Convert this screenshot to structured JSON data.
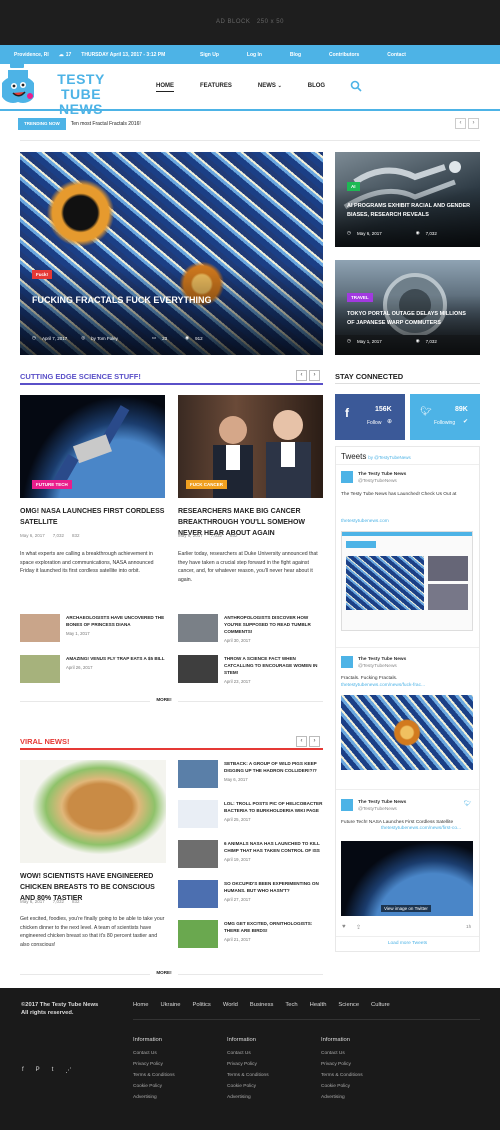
{
  "ad": {
    "label": "AD BLOCK",
    "size": "250 x 50"
  },
  "topbar": {
    "location": "Providence, RI",
    "temp": "17",
    "date": "THURSDAY April 13, 2017 - 3:12 PM",
    "links": [
      "Sign Up",
      "Log In",
      "Blog",
      "Contributors",
      "Contact"
    ]
  },
  "logo": {
    "line1": "TESTY TUBE",
    "line2": "NEWS"
  },
  "nav": [
    "HOME",
    "FEATURES",
    "NEWS",
    "BLOG"
  ],
  "trending": {
    "label": "TRENDING NOW",
    "text": "Ten most Fractal Fractals 2016!"
  },
  "hero": {
    "tag": "Fuck!",
    "title": "FUCKING FRACTALS FUCK EVERYTHING",
    "date": "April 7, 2017",
    "author": "by Tom Foley",
    "comments": "23",
    "views": "912"
  },
  "side": [
    {
      "tag": "AI",
      "title": "AI PROGRAMS EXHIBIT RACIAL AND GENDER BIASES, RESEARCH REVEALS",
      "date": "May 6, 2017",
      "views": "7,032"
    },
    {
      "tag": "TRAVEL",
      "title": "TOKYO PORTAL OUTAGE DELAYS MILLIONS OF JAPANESE WARP COMMUTERS",
      "date": "May 1, 2017",
      "views": "7,032"
    }
  ],
  "science": {
    "title": "CUTTING EDGE SCIENCE STUFF!",
    "main": [
      {
        "tag": "FUTURE TECH",
        "title": "OMG! NASA LAUNCHES FIRST CORDLESS SATELLITE",
        "date": "May 6, 2017",
        "views": "7,032",
        "comments": "832",
        "body": "In what experts are calling a breakthrough achievement in space exploration and communications, NASA announced Friday it launched its first cordless satellite into orbit."
      },
      {
        "tag": "FUCK CANCER",
        "title": "RESEARCHERS MAKE BIG CANCER BREAKTHROUGH YOU'LL SOMEHOW NEVER HEAR ABOUT AGAIN",
        "date": "May 6, 2017",
        "views": "7,032",
        "comments": "832",
        "body": "Earlier today, researchers at Duke University announced that they have taken a crucial step forward in the fight against cancer, and, for whatever reason, you'll never hear about it again."
      }
    ],
    "mini": [
      {
        "title": "ARCHAEOLOGISTS HAVE UNCOVERED THE BONES OF PRINCESS DIANA",
        "date": "May 1, 2017"
      },
      {
        "title": "ANTHROPOLOGISTS DISCOVER HOW YOU'RE SUPPOSED TO READ TUMBLR COMMENTS!",
        "date": "April 30, 2017"
      },
      {
        "title": "AMAZING! VENUS FLY TRAP EATS A $5 BILL",
        "date": "April 26, 2017"
      },
      {
        "title": "THROW A SCIENCE FACT WHEN CATCALLING TO ENCOURAGE WOMEN IN STEM!",
        "date": "April 23, 2017"
      }
    ],
    "more": "MORE!"
  },
  "stay": {
    "title": "STAY CONNECTED",
    "fb_count": "156K",
    "fb_label": "Follow",
    "tw_count": "89K",
    "tw_label": "Following"
  },
  "tweets": {
    "title": "Tweets",
    "by": "by @TestyTubeNews",
    "name": "The Testy Tube News",
    "handle": "@TestyTubeNews",
    "t1": "The Testy Tube News has Launched! Check Us Out at",
    "t1link": "thetestytubenews.com",
    "t2": "Fractals. Fucking Fractals.",
    "t2link": "thetestytubenews.com/news/fuck-frac...",
    "t3": "Future Tech! NASA Launches First Cordless Satellite",
    "t3link": "thetestytubenews.com/news/first-co...",
    "view": "View image on Twitter",
    "time": "1h",
    "load": "Load more Tweets"
  },
  "viral": {
    "title": "VIRAL NEWS!",
    "main": {
      "title": "WOW! SCIENTISTS HAVE ENGINEERED CHICKEN BREASTS TO BE CONSCIOUS AND 80% TASTIER",
      "date": "May 6, 2017",
      "views": "7,032",
      "comments": "832",
      "body": "Get excited, foodies, you're finally going to be able to take your chicken dinner to the next level. A team of scientists have engineered chicken breast so that it's 80 percent tastier and also conscious!"
    },
    "list": [
      {
        "title": "SETBACK: A GROUP OF WILD PIGS KEEP DIGGING UP THE HADRON COLLIDER!?!?",
        "date": "May 6, 2017"
      },
      {
        "title": "LOL: TROLL POSTS PIC OF HELICOBACTER BACTERIA TO BURKHOLDERIA WIKI PAGE",
        "date": "April 25, 2017"
      },
      {
        "title": "6 ANIMALS NASA HAS LAUNCHED TO KILL CHIMP THAT HAS TAKEN CONTROL OF ISS",
        "date": "April 19, 2017"
      },
      {
        "title": "SO OKCUPID'S BEEN EXPERIMENTING ON HUMANS. BUT WHO HASN'T?",
        "date": "April 27, 2017"
      },
      {
        "title": "OMG GET EXCITED, ORNITHOLOGISTS: THERE ARE BIRDS!",
        "date": "April 21, 2017"
      }
    ],
    "more": "MORE!"
  },
  "footer": {
    "copy": "©2017 The Testy Tube News",
    "rights": "All rights reserved.",
    "nav": [
      "Home",
      "Ukraine",
      "Politics",
      "World",
      "Business",
      "Tech",
      "Health",
      "Science",
      "Culture"
    ],
    "col_title": "Information",
    "col_items": [
      "Contact Us",
      "Privacy Policy",
      "Terms & Conditions",
      "Cookie Policy",
      "Advertising"
    ]
  },
  "colors": {
    "accent": "#4db3e6",
    "pink": "#e91e8c",
    "purple": "#7b4fe0",
    "science": "#5a50c8",
    "viral": "#e53935"
  }
}
